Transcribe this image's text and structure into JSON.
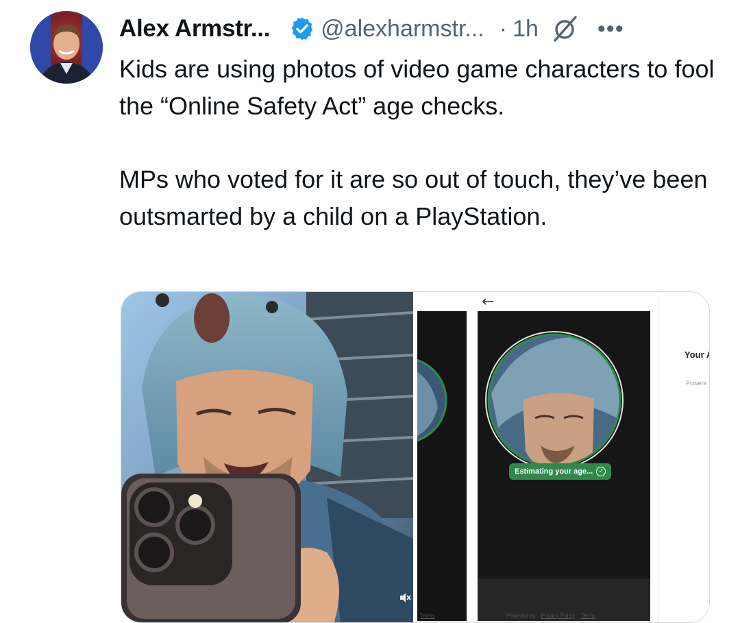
{
  "tweet": {
    "author_name": "Alex Armstr...",
    "handle": "@alexharmstr...",
    "separator": "·",
    "time": "1h",
    "more": "•••",
    "text_paragraphs": [
      "Kids are using photos of video game characters to fool the “Online Safety Act” age checks.",
      "MPs who voted for it are so out of touch, they’ve been outsmarted by a child on a PlayStation."
    ]
  },
  "media": {
    "right_screen": {
      "back_arrow": "←",
      "badge_text": "Estimating your age...",
      "badge_check": "✓",
      "side_title": "Your A",
      "side_powered": "Powere",
      "footer_left": "Terms",
      "footer_powered": "Powered by",
      "footer_privacy": "Privacy Policy",
      "footer_terms": "Terms"
    }
  },
  "colors": {
    "verified": "#1d9bf0",
    "secondary_text": "#536471",
    "badge_green": "#2f8a4a"
  },
  "icons": [
    "verified-badge-icon",
    "grok-icon",
    "more-icon",
    "back-arrow-icon",
    "mute-icon"
  ]
}
